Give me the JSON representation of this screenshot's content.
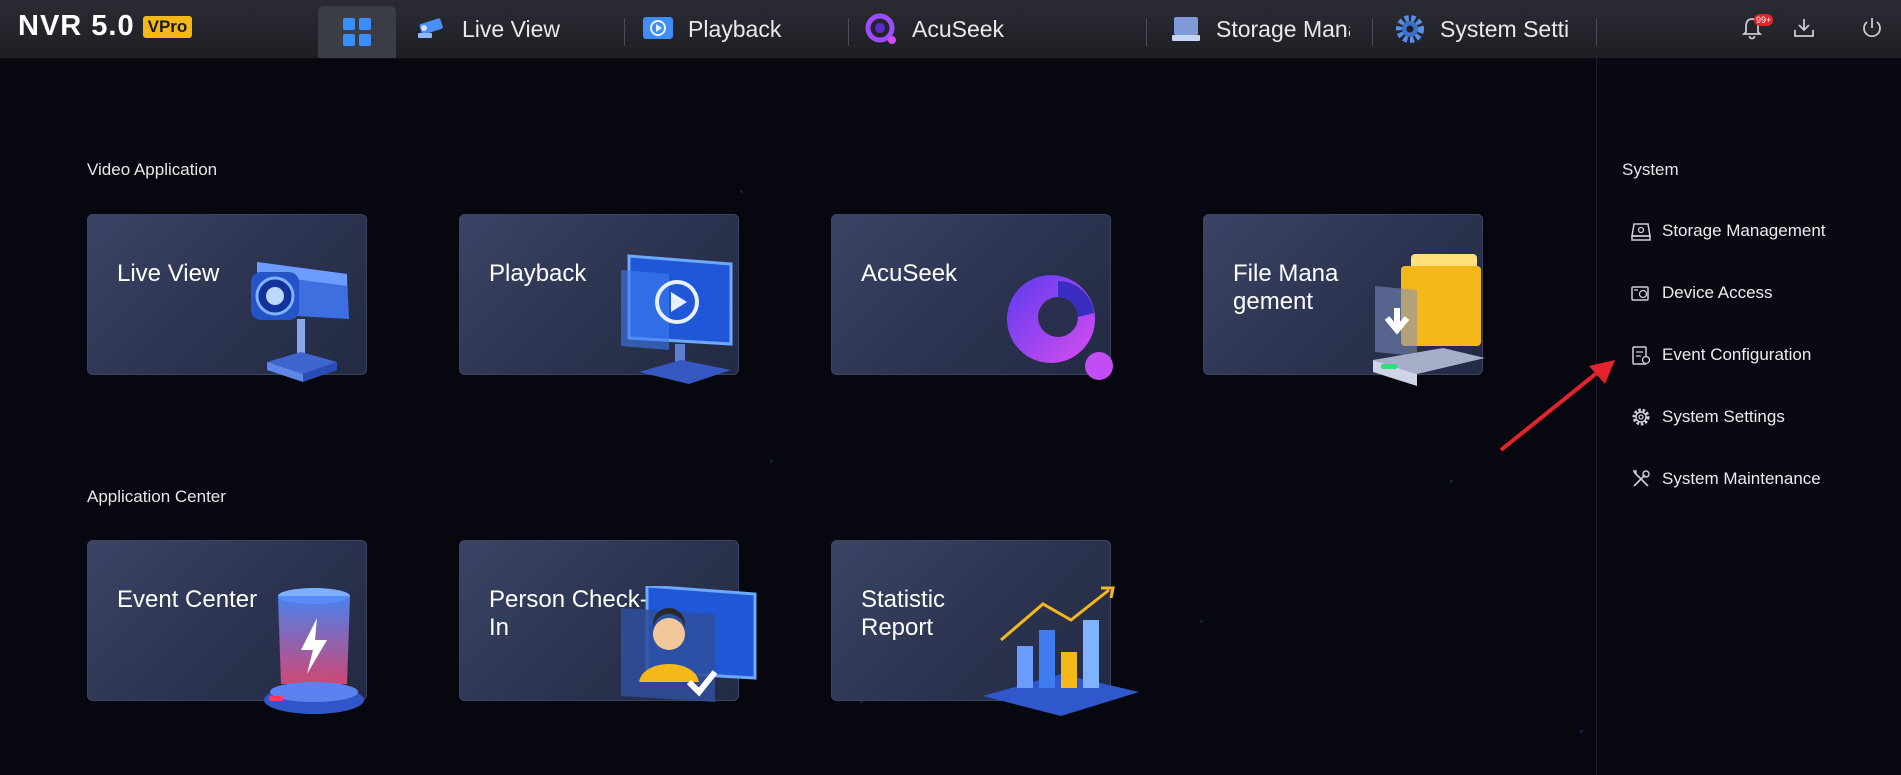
{
  "header": {
    "logo_text": "NVR 5.0",
    "logo_badge": "VPro",
    "tabs": [
      {
        "label": "Live View",
        "icon": "camera-icon"
      },
      {
        "label": "Playback",
        "icon": "playback-icon"
      },
      {
        "label": "AcuSeek",
        "icon": "acuseek-icon"
      },
      {
        "label": "Storage Mana",
        "icon": "storage-icon"
      },
      {
        "label": "System Settin",
        "icon": "gear-icon"
      }
    ],
    "notification_count": "99+"
  },
  "sections": {
    "video_application": {
      "title": "Video Application",
      "cards": [
        {
          "label": "Live View"
        },
        {
          "label": "Playback"
        },
        {
          "label": "AcuSeek"
        },
        {
          "label": "File Mana gement"
        }
      ]
    },
    "application_center": {
      "title": "Application Center",
      "cards": [
        {
          "label": "Event Center"
        },
        {
          "label": "Person Check-In"
        },
        {
          "label": "Statistic Report"
        }
      ]
    }
  },
  "system_panel": {
    "title": "System",
    "items": [
      {
        "label": "Storage Management",
        "icon": "storage-management-icon"
      },
      {
        "label": "Device Access",
        "icon": "device-access-icon"
      },
      {
        "label": "Event Configuration",
        "icon": "event-configuration-icon"
      },
      {
        "label": "System Settings",
        "icon": "gear-icon"
      },
      {
        "label": "System Maintenance",
        "icon": "tools-icon"
      }
    ]
  },
  "colors": {
    "accent_blue": "#3a8dff",
    "badge_yellow": "#f5b81b",
    "annotation_red": "#e4232d"
  }
}
